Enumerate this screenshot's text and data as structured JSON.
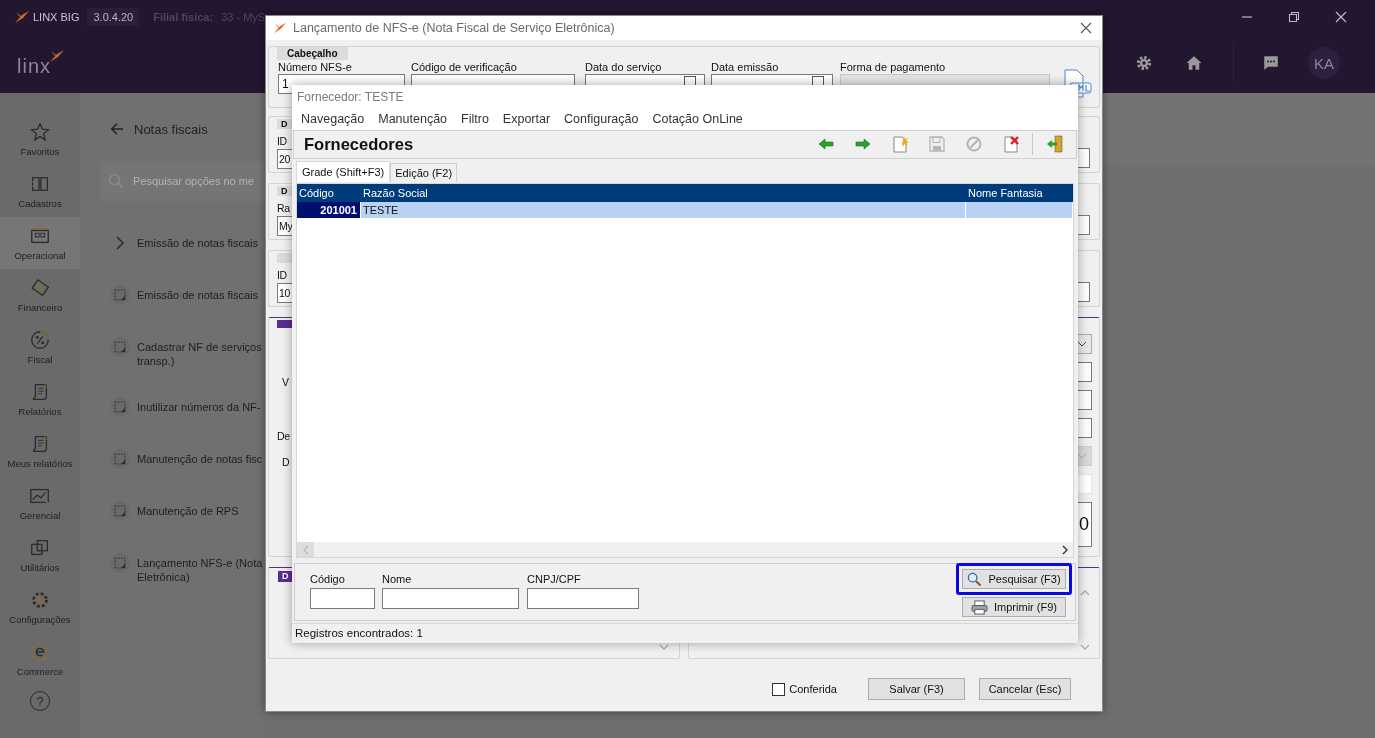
{
  "app": {
    "name": "LINX BIG",
    "version": "3.0.4.20",
    "branch_label": "Filial física:",
    "branch_value": "33 - MyS",
    "logo": "linx",
    "user_initials": "KA"
  },
  "sidebar": [
    {
      "label": "Favoritos",
      "selected": false
    },
    {
      "label": "Cadastros",
      "selected": false
    },
    {
      "label": "Operacional",
      "selected": true
    },
    {
      "label": "Financeiro",
      "selected": false
    },
    {
      "label": "Fiscal",
      "selected": false
    },
    {
      "label": "Relatórios",
      "selected": false
    },
    {
      "label": "Meus relatórios",
      "selected": false
    },
    {
      "label": "Gerencial",
      "selected": false
    },
    {
      "label": "Utilitários",
      "selected": false
    },
    {
      "label": "Configurações",
      "selected": false
    },
    {
      "label": "Commerce",
      "selected": false
    }
  ],
  "help": {
    "glyph": "?"
  },
  "menu_panel": {
    "title": "Notas fiscais",
    "search_placeholder": "Pesquisar opções no me",
    "items": [
      {
        "kind": "group",
        "lines": [
          "Emissão de notas fiscais"
        ]
      },
      {
        "kind": "link",
        "lines": [
          "Emissão de notas fiscais"
        ]
      },
      {
        "kind": "link",
        "lines": [
          "Cadastrar NF de serviços",
          "transp.)"
        ]
      },
      {
        "kind": "link",
        "lines": [
          "Inutilizar números da NF-"
        ]
      },
      {
        "kind": "link",
        "lines": [
          "Manutenção de notas fisc"
        ]
      },
      {
        "kind": "link",
        "lines": [
          "Manutenção de RPS"
        ]
      },
      {
        "kind": "link",
        "lines": [
          "Lançamento NFS-e (Nota",
          "Eletrônica)"
        ]
      }
    ]
  },
  "dialog": {
    "title": "Lançamento de NFS-e (Nota Fiscal de Serviço Eletrônica)",
    "header": {
      "title": "Cabeçalho",
      "fields": [
        {
          "label": "Número NFS-e",
          "value": "1",
          "disabled": false
        },
        {
          "label": "Código de verificação",
          "disabled": false
        },
        {
          "kind": "date",
          "label": "Data do serviço",
          "disabled": false
        },
        {
          "kind": "date",
          "label": "Data emissão",
          "disabled": false
        },
        {
          "label": "Forma de pagamento",
          "disabled": true
        }
      ]
    },
    "groups": [
      {
        "kind": "field",
        "tab": "D",
        "label": "ID",
        "value": "20"
      },
      {
        "kind": "field",
        "tab": "D",
        "label": "Ra",
        "value": "My"
      },
      {
        "kind": "field",
        "label": "ID",
        "value": "10"
      },
      {
        "kind": "section",
        "labels": [
          "V",
          "De",
          "D"
        ],
        "amount": "0"
      },
      {
        "kind": "split",
        "tab": "D"
      }
    ],
    "conferida": {
      "label": "Conferida",
      "checked": false
    },
    "buttons": [
      "Salvar (F3)",
      "Cancelar (Esc)"
    ]
  },
  "lookup": {
    "title": "Fornecedor: TESTE",
    "menu": [
      "Navegação",
      "Manutenção",
      "Filtro",
      "Exportar",
      "Configuração",
      "Cotação OnLine"
    ],
    "heading": "Fornecedores",
    "toolbar": [
      {
        "kind": "back",
        "disabled": false
      },
      {
        "kind": "forward",
        "disabled": false
      },
      {
        "kind": "new",
        "disabled": false
      },
      {
        "kind": "save",
        "disabled": true
      },
      {
        "kind": "cancel",
        "disabled": true
      },
      {
        "kind": "delete",
        "disabled": false
      },
      {
        "kind": "exit",
        "disabled": false
      }
    ],
    "tabs": [
      {
        "label": "Grade (Shift+F3)",
        "selected": true
      },
      {
        "label": "Edição (F2)",
        "selected": false
      }
    ],
    "table": {
      "columns": [
        "Código",
        "Razão Social",
        "Nome Fantasia"
      ],
      "rows": [
        {
          "cells": [
            "201001",
            "TESTE"
          ],
          "selected": true
        }
      ]
    },
    "filters": [
      {
        "label": "Código"
      },
      {
        "label": "Nome"
      },
      {
        "label": "CNPJ/CPF"
      }
    ],
    "buttons": [
      {
        "kind": "search",
        "label": "Pesquisar (F3)",
        "focused": true
      },
      {
        "kind": "print",
        "label": "Imprimir (F9)",
        "focused": false
      }
    ],
    "status": "Registros encontrados: 1"
  }
}
